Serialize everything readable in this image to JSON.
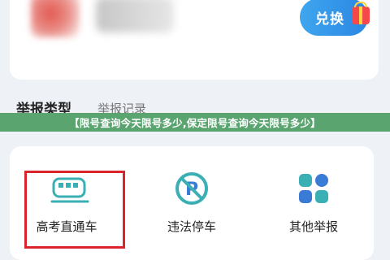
{
  "header": {
    "redeem_label": "兑换"
  },
  "tabs": [
    {
      "label": "举报类型"
    },
    {
      "label": "举报记录"
    }
  ],
  "banner": {
    "text": "【限号查询今天限号多少,保定限号查询今天限号多少】"
  },
  "categories": [
    {
      "label": "高考直通车",
      "icon": "train-icon"
    },
    {
      "label": "违法停车",
      "icon": "no-parking-icon"
    },
    {
      "label": "其他举报",
      "icon": "grid-icon"
    }
  ],
  "colors": {
    "accent": "#2a86e3",
    "teal": "#3ab0b5",
    "banner": "#5aa46f",
    "highlight": "#d9242c"
  }
}
